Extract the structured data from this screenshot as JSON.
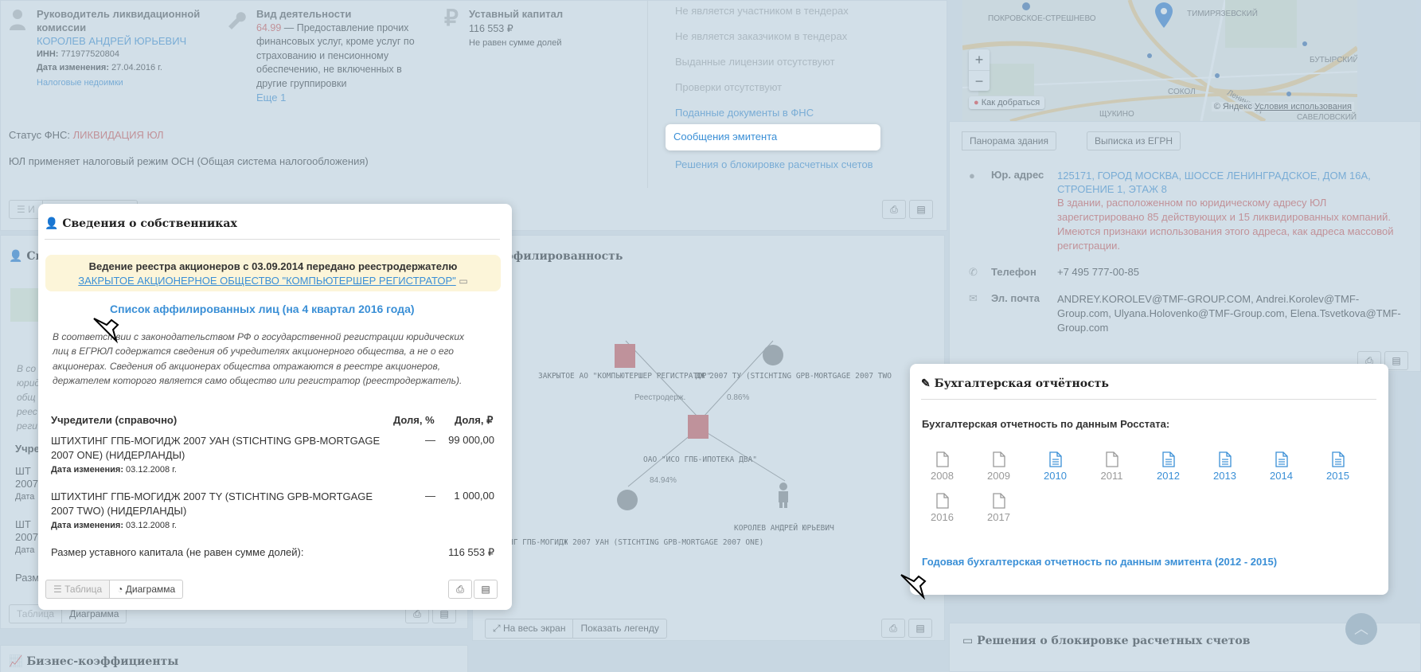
{
  "head": {
    "liquidator": {
      "label": "Руководитель ликвидационной комиссии",
      "name": "КОРОЛЕВ АНДРЕЙ ЮРЬЕВИЧ",
      "inn_label": "ИНН:",
      "inn": "771977520804",
      "changed_label": "Дата изменения:",
      "changed": "27.04.2016 г.",
      "tax_link": "Налоговые недоимки"
    },
    "activity": {
      "label": "Вид деятельности",
      "code": "64.99",
      "text": "— Предоставление прочих финансовых услуг, кроме услуг по страхованию и пенсионному обеспечению, не включенных в другие группировки",
      "more": "Еще 1"
    },
    "capital": {
      "label": "Уставный капитал",
      "value": "116 553 ₽",
      "note": "Не равен сумме долей"
    },
    "fns_status_label": "Статус ФНС:",
    "fns_status": "ЛИКВИДАЦИЯ ЮЛ",
    "tax_regime": "ЮЛ применяет налоговый режим ОСН (Общая система налогообложения)"
  },
  "links_list": {
    "items": [
      "Не является участником в тендерах",
      "Не является заказчиком в тендерах",
      "Выданные лицензии отсутствуют",
      "Проверки отсутствуют",
      "Поданные документы в ФНС",
      "Сообщения эмитента",
      "Решения о блокировке расчетных счетов"
    ]
  },
  "map": {
    "labels": [
      "ПОКРОВСКОЕ-СТРЕШНЕВО",
      "ТИМИРЯЗЕВСКИЙ",
      "БУТЫРСКИЙ",
      "СОКОЛ",
      "ЩУКИНО",
      "САВЕЛОВСКИЙ",
      "Ленинград"
    ],
    "route_button": "Как добраться",
    "copyright": "© Яндекс",
    "terms": "Условия использования",
    "zoom_in": "+",
    "zoom_out": "−",
    "panorama_button": "Панорама здания",
    "egrn_button": "Выписка из ЕГРН"
  },
  "contacts": {
    "address_label": "Юр. адрес",
    "address": "125171, ГОРОД МОСКВА, ШОССЕ ЛЕНИНГРАДСКОЕ, ДОМ 16А, СТРОЕНИЕ 1, ЭТАЖ 8",
    "address_warning": "В здании, расположенном по юридическому адресу ЮЛ зарегистрировано 85 действующих и 15 ликвидированных компаний. Имеются признаки использования этого адреса, как адреса массовой регистрации.",
    "phone_label": "Телефон",
    "phone": "+7 495 777-00-85",
    "email_label": "Эл. почта",
    "email": "ANDREY.KOROLEV@TMF-GROUP.COM, Andrei.Korolev@TMF-Group.com, Ulyana.Holovenko@TMF-Group.com, Elena.Tsvetkova@TMF-Group.com"
  },
  "affiliation": {
    "title": "ффилированность",
    "nodes": {
      "registrar": "ЗАКРЫТОЕ АО \"КОМПЬЮТЕРШЕР РЕГИСТРАТОР\"",
      "stichting_two": "ДЖ 2007 ТУ (STICHTING GPB-MORTGAGE 2007 TWO",
      "main": "ОАО \"ИСО ГПБ-ИПОТЕКА ДВА\"",
      "stichting_one": "НГ ГПБ-МОГИДЖ 2007 УАН (STICHTING GPB-MORTGAGE 2007 ONE)",
      "person": "КОРОЛЕВ АНДРЕЙ ЮРЬЕВИЧ"
    },
    "edges": {
      "registrar": "Реестродерж.",
      "two": "0.86%",
      "one": "84.94%"
    },
    "fullscreen": "На весь экран",
    "legend": "Показать легенду"
  },
  "bg_misc": {
    "owners_title_partial": "Све",
    "table_btn": "Таблица",
    "diagram_btn": "Диаграмма",
    "biz_title": "Бизнес-коэффициенты",
    "block_title": "Решения о блокировке расчетных счетов",
    "frag_text": [
      "В со",
      "юрид",
      "общ",
      "реес",
      "реги"
    ],
    "frag_founders": "Учре",
    "frag_sht1": [
      "ШТ",
      "2007",
      "Дата"
    ],
    "frag_sht2": [
      "ШТ",
      "2007",
      "Дата"
    ],
    "frag_razm": "Разм"
  },
  "owners_modal": {
    "title": "Сведения о собственниках",
    "notice_text": "Ведение реестра акционеров с 03.09.2014 передано реестродержателю",
    "notice_link": "ЗАКРЫТОЕ АКЦИОНЕРНОЕ ОБЩЕСТВО \"КОМПЬЮТЕРШЕР РЕГИСТРАТОР\"",
    "affiliates_link": "Список аффилированных лиц (на 4 квартал 2016 года)",
    "description": "В соответствии с законодательством РФ о государственной регистрации юридических лиц в ЕГРЮЛ содержатся сведения об учредителях акционерного общества, а не о его акционерах. Сведения об акционерах общества отражаются в реестре акционеров, держателем которого является само общество или регистратор (реестродержатель).",
    "columns": [
      "Учредители (справочно)",
      "Доля, %",
      "Доля, ₽"
    ],
    "rows": [
      {
        "name": "ШТИХТИНГ ГПБ-МОГИДЖ 2007 УАН (STICHTING GPB-MORTGAGE 2007 ONE) (НИДЕРЛАНДЫ)",
        "changed_label": "Дата изменения:",
        "changed": "03.12.2008 г.",
        "share_pct": "—",
        "share_rub": "99 000,00"
      },
      {
        "name": "ШТИХТИНГ ГПБ-МОГИДЖ 2007 TY (STICHTING GPB-MORTGAGE 2007 TWO) (НИДЕРЛАНДЫ)",
        "changed_label": "Дата изменения:",
        "changed": "03.12.2008 г.",
        "share_pct": "—",
        "share_rub": "1 000,00"
      }
    ],
    "capital_label": "Размер уставного капитала (не равен сумме долей):",
    "capital_value": "116 553 ₽",
    "table_btn": "Таблица",
    "diagram_btn": "Диаграмма"
  },
  "accounting_modal": {
    "title": "Бухгалтерская отчётность",
    "subtitle": "Бухгалтерская отчетность по данным Росстата:",
    "years": [
      {
        "year": "2008",
        "available": false
      },
      {
        "year": "2009",
        "available": false
      },
      {
        "year": "2010",
        "available": true
      },
      {
        "year": "2011",
        "available": false
      },
      {
        "year": "2012",
        "available": true
      },
      {
        "year": "2013",
        "available": true
      },
      {
        "year": "2014",
        "available": true
      },
      {
        "year": "2015",
        "available": true
      },
      {
        "year": "2016",
        "available": false
      },
      {
        "year": "2017",
        "available": false
      }
    ],
    "annual_link": "Годовая бухгалтерская отчетность по данным эмитента (2012 - 2015)"
  },
  "colors": {
    "link": "#3a8fd6",
    "danger": "#d9534f",
    "notice_bg": "#fcf5d9",
    "overlay": "#adc4d6"
  }
}
